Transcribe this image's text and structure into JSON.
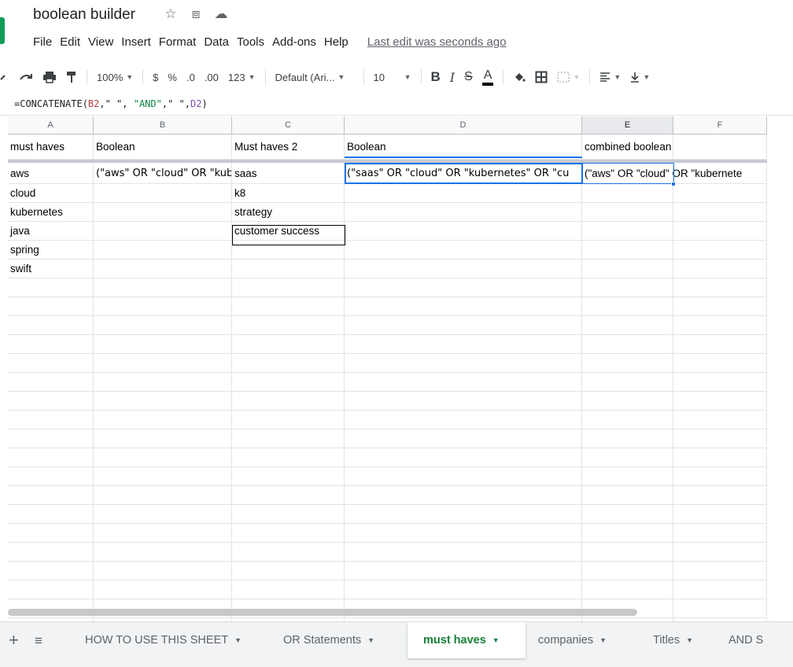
{
  "title": "boolean builder",
  "icons": {
    "star": "☆",
    "move": "⧈",
    "cloud": "☁"
  },
  "menu": [
    "File",
    "Edit",
    "View",
    "Insert",
    "Format",
    "Data",
    "Tools",
    "Add-ons",
    "Help"
  ],
  "last_edit": "Last edit was seconds ago",
  "toolbar": {
    "zoom": "100%",
    "currency": "$",
    "percent": "%",
    "dec_less": ".0",
    "dec_more": ".00",
    "format_more": "123",
    "font": "Default (Ari...",
    "font_size": "10",
    "bold": "B",
    "italic": "I",
    "strike": "S",
    "text_color": "A"
  },
  "formula": {
    "fn": "=CONCATENATE(",
    "ref1": "B2",
    "rest1": ",\" \", ",
    "str": "\"AND\"",
    "rest2": ",\" \",",
    "ref2": "D2",
    "close": ")"
  },
  "columns": [
    "A",
    "B",
    "C",
    "D",
    "E",
    "F"
  ],
  "header_row": [
    "must haves",
    "Boolean",
    "Must haves 2",
    "Boolean",
    "combined boolean",
    ""
  ],
  "rows": [
    [
      "aws",
      "(\"aws\" OR \"cloud\" OR \"kubernetes\"",
      "saas",
      "(\"saas\" OR \"cloud\" OR \"kubernetes\" OR \"cu",
      "(\"aws\" OR \"cloud\" OR \"kubernete",
      ""
    ],
    [
      "cloud",
      "",
      "k8",
      "",
      "",
      ""
    ],
    [
      "kubernetes",
      "",
      "strategy",
      "",
      "",
      ""
    ],
    [
      "java",
      "",
      "customer success",
      "",
      "",
      ""
    ],
    [
      "spring",
      "",
      "",
      "",
      "",
      ""
    ],
    [
      "swift",
      "",
      "",
      "",
      "",
      ""
    ]
  ],
  "sheets": [
    {
      "name": "HOW TO USE THIS SHEET",
      "active": false
    },
    {
      "name": "OR Statements",
      "active": false
    },
    {
      "name": "must haves",
      "active": true
    },
    {
      "name": "companies",
      "active": false
    },
    {
      "name": "Titles",
      "active": false
    },
    {
      "name": "AND S",
      "active": false
    }
  ],
  "colors": {
    "accent": "#1a73e8",
    "active_tab": "#188038",
    "logo": "#0f9d58"
  }
}
